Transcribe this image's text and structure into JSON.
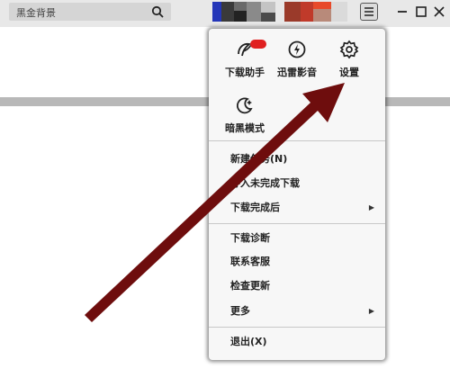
{
  "search": {
    "value": "黑金背景"
  },
  "dropdown": {
    "tiles": [
      {
        "label": "下载助手",
        "badge": ""
      },
      {
        "label": "迅雷影音"
      },
      {
        "label": "设置"
      },
      {
        "label": "暗黑模式"
      }
    ],
    "menu": [
      {
        "label": "新建任务(N)"
      },
      {
        "label": "导入未完成下载"
      },
      {
        "label": "下载完成后",
        "submenu": true
      },
      {
        "label": "下载诊断"
      },
      {
        "label": "联系客服"
      },
      {
        "label": "检查更新"
      },
      {
        "label": "更多",
        "submenu": true
      },
      {
        "label": "退出(X)"
      }
    ]
  },
  "colors": {
    "arrow": "#6e0d0d",
    "badge": "#e02020"
  }
}
